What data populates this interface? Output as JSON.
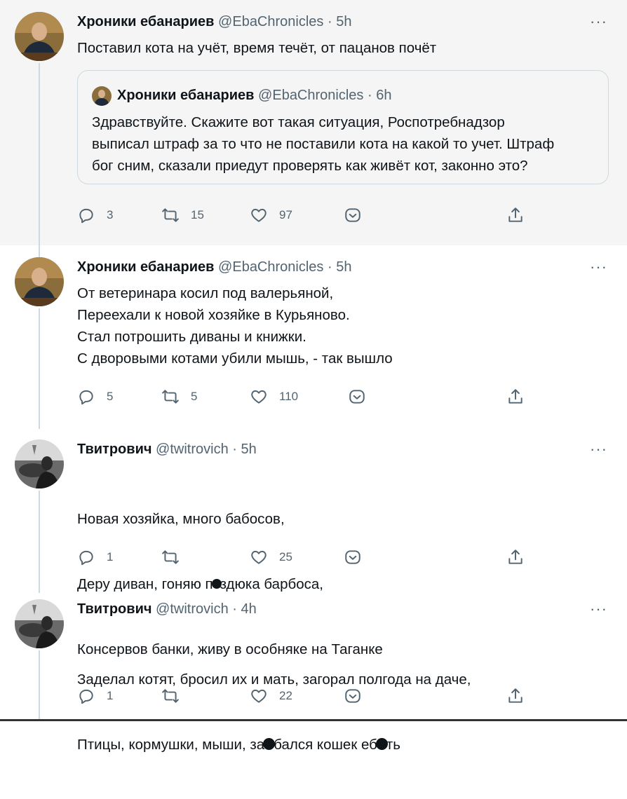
{
  "tweets": [
    {
      "name": "Хроники ебанариев",
      "meta": "@EbaChronicles · 5h",
      "text": "Поставил кота на учёт, время течёт, от пацанов почёт",
      "quote": {
        "name": "Хроники ебанариев",
        "meta": "@EbaChronicles · 6h",
        "text": "Здравствуйте. Скажите вот такая ситуация, Роспотребнадзор\nвыписал штраф за то что не поставили кота на какой то учет. Штраф\nбог сним, сказали приедут проверять как живёт кот, законно это?"
      },
      "replies": "3",
      "retweets": "15",
      "likes": "97"
    },
    {
      "name": "Хроники ебанариев",
      "meta": "@EbaChronicles · 5h",
      "text": "От ветеринара косил под валерьяной,\nПереехали к новой хозяйке в Курьяново.\nСтал потрошить диваны и книжки.\nС дворовыми котами убили мышь, - так вышло",
      "replies": "5",
      "retweets": "5",
      "likes": "110"
    },
    {
      "name": "Твитрович",
      "meta": "@twitrovich · 5h",
      "line1": "Новая хозяйка, много бабосов,",
      "line2a": "Деру диван, гоняю п",
      "line2b": "здюка барбоса,",
      "line3": "Консервов банки, живу в особняке на Таганке",
      "replies": "1",
      "retweets": "",
      "likes": "25"
    },
    {
      "name": "Твитрович",
      "meta": "@twitrovich · 4h",
      "line1": "Заделал котят, бросил их и мать, загорал полгода на даче,",
      "line2a": "Птицы, кормушки, мыши, за",
      "line2b": "бался кошек еб",
      "line2c": "ть",
      "replies": "1",
      "retweets": "",
      "likes": "22"
    }
  ],
  "more_label": "···",
  "icons": {
    "reply": "reply-icon",
    "retweet": "retweet-icon",
    "like": "heart-icon",
    "bookmark": "bookmark-icon",
    "share": "share-icon"
  },
  "colors": {
    "text": "#0f1419",
    "secondary": "#536471",
    "highlight_bg": "#f5f5f5",
    "border": "#cfd9de"
  }
}
